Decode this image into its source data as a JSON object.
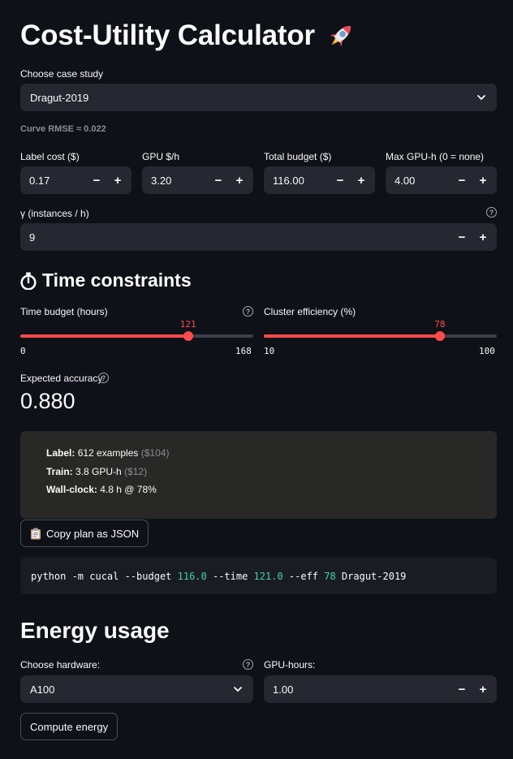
{
  "app": {
    "title": "Cost-Utility Calculator",
    "title_icon": "rocket-icon"
  },
  "case_study": {
    "label": "Choose case study",
    "selected": "Dragut-2019",
    "caption": "Curve RMSE ≈ 0.022"
  },
  "inputs": {
    "label_cost": {
      "label": "Label cost ($)",
      "value": "0.17"
    },
    "gpu_rate": {
      "label": "GPU $/h",
      "value": "3.20"
    },
    "total_budget": {
      "label": "Total budget ($)",
      "value": "116.00"
    },
    "max_gpu_h": {
      "label": "Max GPU-h (0 = none)",
      "value": "4.00"
    },
    "gamma": {
      "label": "γ (instances / h)",
      "value": "9"
    },
    "minus": "−",
    "plus": "+"
  },
  "time_constraints": {
    "heading": "Time constraints",
    "heading_icon": "stopwatch-icon",
    "time_budget": {
      "label": "Time budget (hours)",
      "value": 121,
      "min": 0,
      "max": 168,
      "value_text": "121",
      "min_text": "0",
      "max_text": "168"
    },
    "cluster_eff": {
      "label": "Cluster efficiency (%)",
      "value": 78,
      "min": 10,
      "max": 100,
      "value_text": "78",
      "min_text": "10",
      "max_text": "100"
    }
  },
  "metric": {
    "label": "Expected accuracy",
    "value": "0.880"
  },
  "plan": {
    "label_title": "Label:",
    "label_text": "612 examples",
    "label_cost": "($104)",
    "train_title": "Train:",
    "train_text": "3.8 GPU-h",
    "train_cost": "($12)",
    "wall_title": "Wall-clock:",
    "wall_text": "4.8 h @ 78%"
  },
  "copy_button": {
    "label": "Copy plan as JSON",
    "icon": "clipboard-icon"
  },
  "command": {
    "p1": "python -m cucal --budget ",
    "n1": "116.0",
    "p2": " --time ",
    "n2": "121.0",
    "p3": " --eff ",
    "n3": "78",
    "p4": " Dragut-2019"
  },
  "energy": {
    "heading": "Energy usage",
    "hardware_label": "Choose hardware:",
    "hardware_selected": "A100",
    "gpu_hours_label": "GPU-hours:",
    "gpu_hours_value": "1.00",
    "compute_button": "Compute energy"
  },
  "colors": {
    "background": "#0e1117",
    "widget": "#262730",
    "accent": "#ff4b4b",
    "code_number": "#3dd5b0"
  }
}
